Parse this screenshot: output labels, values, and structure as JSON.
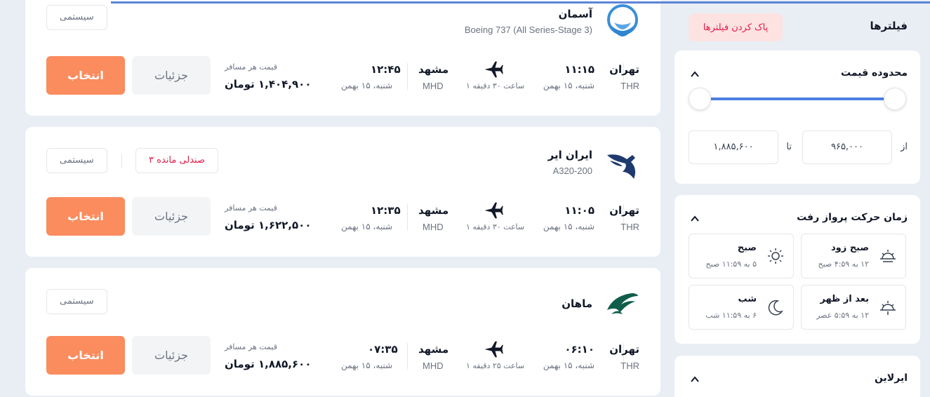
{
  "colors": {
    "accent": "#fa8c5e",
    "slider": "#4a80e0",
    "danger": "#e11d48"
  },
  "flights": [
    {
      "airline": "آسمان",
      "aircraft": "Boeing 737 (All Series-Stage 3)",
      "tags": [
        "سیستمی"
      ],
      "seats_left": "",
      "dep_city": "تهران",
      "dep_code": "THR",
      "dep_time": "۱۱:۱۵",
      "dep_date": "شنبه، ۱۵ بهمن",
      "duration": "۱ ساعت ۳۰ دقیقه",
      "arr_city": "مشهد",
      "arr_code": "MHD",
      "arr_time": "۱۲:۴۵",
      "arr_date": "شنبه، ۱۵ بهمن",
      "price_label": "قیمت هر مسافر",
      "price": "۱,۴۰۴,۹۰۰ تومان",
      "details_label": "جزئیات",
      "select_label": "انتخاب",
      "logo": "aseman-logo"
    },
    {
      "airline": "ایران ایر",
      "aircraft": "A320-200",
      "tags": [
        "سیستمی"
      ],
      "seats_left": "۳ صندلی مانده",
      "dep_city": "تهران",
      "dep_code": "THR",
      "dep_time": "۱۱:۰۵",
      "dep_date": "شنبه، ۱۵ بهمن",
      "duration": "۱ ساعت ۳۰ دقیقه",
      "arr_city": "مشهد",
      "arr_code": "MHD",
      "arr_time": "۱۲:۳۵",
      "arr_date": "شنبه، ۱۵ بهمن",
      "price_label": "قیمت هر مسافر",
      "price": "۱,۶۲۲,۵۰۰ تومان",
      "details_label": "جزئیات",
      "select_label": "انتخاب",
      "logo": "iranair-logo"
    },
    {
      "airline": "ماهان",
      "aircraft": "",
      "tags": [
        "سیستمی"
      ],
      "seats_left": "",
      "dep_city": "تهران",
      "dep_code": "THR",
      "dep_time": "۰۶:۱۰",
      "dep_date": "شنبه، ۱۵ بهمن",
      "duration": "۱ ساعت ۲۵ دقیقه",
      "arr_city": "مشهد",
      "arr_code": "MHD",
      "arr_time": "۰۷:۳۵",
      "arr_date": "شنبه، ۱۵ بهمن",
      "price_label": "قیمت هر مسافر",
      "price": "۱,۸۸۵,۶۰۰ تومان",
      "details_label": "جزئیات",
      "select_label": "انتخاب",
      "logo": "mahan-logo"
    }
  ],
  "filters": {
    "title": "فیلترها",
    "clear_label": "پاک کردن فیلترها",
    "price_range": {
      "title": "محدوده قیمت",
      "from_label": "از",
      "to_label": "تا",
      "from_value": "۹۶۵,۰۰۰",
      "to_value": "۱,۸۸۵,۶۰۰",
      "selected_min_fraction": 0,
      "selected_max_fraction": 1
    },
    "departure_time": {
      "title": "زمان حرکت پرواز رفت",
      "options": [
        {
          "name": "صبح زود",
          "range": "۱۲ به ۴:۵۹ صبح",
          "icon": "sunrise-icon"
        },
        {
          "name": "صبح",
          "range": "۵ به ۱۱:۵۹ صبح",
          "icon": "sun-icon"
        },
        {
          "name": "بعد از ظهر",
          "range": "۱۲ به ۵:۵۹ عصر",
          "icon": "sunset-icon"
        },
        {
          "name": "شب",
          "range": "۶ به ۱۱:۵۹ شب",
          "icon": "moon-icon"
        }
      ]
    },
    "airline": {
      "title": "ایرلاین"
    }
  }
}
